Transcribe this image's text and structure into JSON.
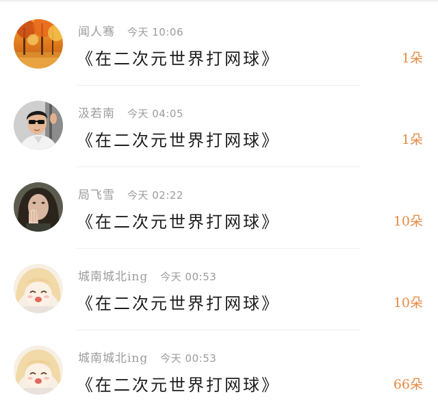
{
  "items": [
    {
      "name": "闻人骞",
      "time": "今天 10:06",
      "title": "《在二次元世界打网球》",
      "count": "1朵",
      "avatar": "autumn-forest-avatar"
    },
    {
      "name": "汲若南",
      "time": "今天 04:05",
      "title": "《在二次元世界打网球》",
      "count": "1朵",
      "avatar": "man-sunglasses-avatar"
    },
    {
      "name": "局飞雪",
      "time": "今天 02:22",
      "title": "《在二次元世界打网球》",
      "count": "10朵",
      "avatar": "woman-covering-face-avatar"
    },
    {
      "name": "城南城北ing",
      "time": "今天 00:53",
      "title": "《在二次元世界打网球》",
      "count": "10朵",
      "avatar": "anime-girl-avatar"
    },
    {
      "name": "城南城北ing",
      "time": "今天 00:53",
      "title": "《在二次元世界打网球》",
      "count": "66朵",
      "avatar": "anime-girl-avatar"
    }
  ],
  "colors": {
    "count": "#e58a44",
    "meta": "#9b9b9b",
    "title": "#1d1d1d"
  }
}
